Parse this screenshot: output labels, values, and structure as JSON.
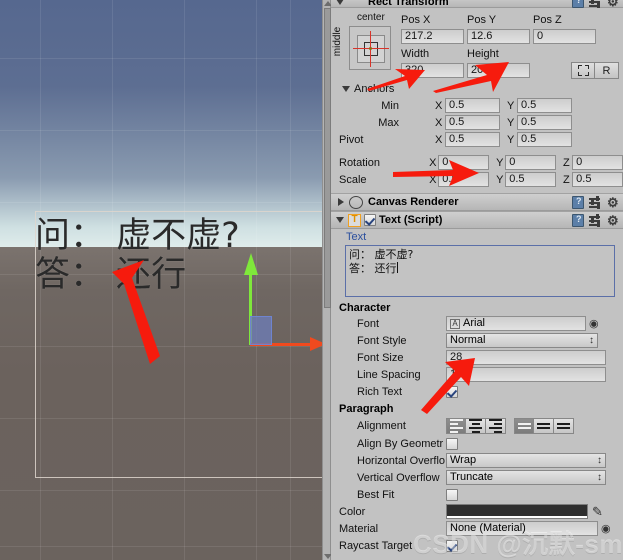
{
  "scene": {
    "name": "scene-view",
    "text_line1": "问： 虚不虚?",
    "text_line2": "答： 还行",
    "sky_color": "#56688f",
    "ground_color": "#6b625d",
    "gizmo": {
      "x_axis_color": "#f04a1e",
      "y_axis_color": "#7fe83b",
      "z_plane_color": "#6f84d0"
    }
  },
  "inspector": {
    "rect_transform": {
      "title": "Rect Transform",
      "anchor_preset_horizontal": "center",
      "anchor_preset_vertical": "middle",
      "pos_x_label": "Pos X",
      "pos_y_label": "Pos Y",
      "pos_z_label": "Pos Z",
      "pos_x": "217.2",
      "pos_y": "12.6",
      "pos_z": "0",
      "width_label": "Width",
      "height_label": "Height",
      "width": "320",
      "height": "200",
      "blueprint_label": "",
      "raw_label": "R",
      "anchors_label": "Anchors",
      "min_label": "Min",
      "max_label": "Max",
      "pivot_label": "Pivot",
      "rotation_label": "Rotation",
      "scale_label": "Scale",
      "axis_x": "X",
      "axis_y": "Y",
      "axis_z": "Z",
      "min_x": "0.5",
      "min_y": "0.5",
      "max_x": "0.5",
      "max_y": "0.5",
      "pivot_x": "0.5",
      "pivot_y": "0.5",
      "rot_x": "0",
      "rot_y": "0",
      "rot_z": "0",
      "scale_x": "0.5",
      "scale_y": "0.5",
      "scale_z": "0.5"
    },
    "canvas_renderer": {
      "title": "Canvas Renderer"
    },
    "text_script": {
      "title": "Text (Script)",
      "icon_letter": "T",
      "enabled": true,
      "text_prop_label": "Text",
      "text_value_line1": "问： 虚不虚?",
      "text_value_line2": "答： 还行",
      "character_header": "Character",
      "font_label": "Font",
      "font_value": "Arial",
      "font_style_label": "Font Style",
      "font_style_value": "Normal",
      "font_size_label": "Font Size",
      "font_size_value": "28",
      "line_spacing_label": "Line Spacing",
      "line_spacing_value": "1",
      "rich_text_label": "Rich Text",
      "rich_text_checked": true,
      "paragraph_header": "Paragraph",
      "alignment_label": "Alignment",
      "alignment_horizontal": "left",
      "alignment_vertical": "top",
      "align_by_geometry_label": "Align By Geometr",
      "align_by_geometry_checked": false,
      "horizontal_overflow_label": "Horizontal Overflo",
      "horizontal_overflow_value": "Wrap",
      "vertical_overflow_label": "Vertical Overflow",
      "vertical_overflow_value": "Truncate",
      "best_fit_label": "Best Fit",
      "best_fit_checked": false,
      "color_label": "Color",
      "color_value": "#2f2f2f",
      "material_label": "Material",
      "material_value": "None (Material)",
      "raycast_target_label": "Raycast Target",
      "raycast_target_checked": true
    }
  },
  "watermark": {
    "text": "CSDN @沉默-smart"
  }
}
